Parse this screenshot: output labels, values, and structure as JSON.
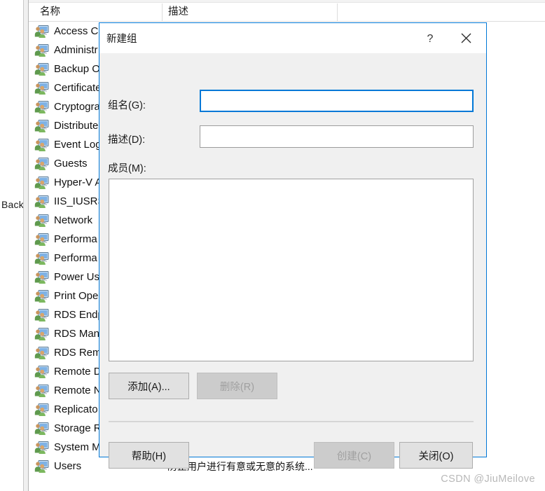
{
  "background": {
    "back_label": "Back",
    "columns": [
      {
        "key": "name",
        "label": "名称"
      },
      {
        "key": "desc",
        "label": "描述"
      },
      {
        "key": "extra",
        "label": ""
      }
    ],
    "rows": [
      {
        "icon": "user-group-icon",
        "name": "Access Co",
        "desc": ""
      },
      {
        "icon": "user-group-icon",
        "name": "Administr",
        "desc": ""
      },
      {
        "icon": "user-group-icon",
        "name": "Backup O",
        "desc": ""
      },
      {
        "icon": "user-group-icon",
        "name": "Certificate",
        "desc": ""
      },
      {
        "icon": "user-group-icon",
        "name": "Cryptogra",
        "desc": ""
      },
      {
        "icon": "user-group-icon",
        "name": "Distribute",
        "desc": ""
      },
      {
        "icon": "user-group-icon",
        "name": "Event Log",
        "desc": ""
      },
      {
        "icon": "user-group-icon",
        "name": "Guests",
        "desc": ""
      },
      {
        "icon": "user-group-icon",
        "name": "Hyper-V A",
        "desc": ""
      },
      {
        "icon": "user-group-icon",
        "name": "IIS_IUSRS",
        "desc": ""
      },
      {
        "icon": "user-group-icon",
        "name": "Network",
        "desc": ""
      },
      {
        "icon": "user-group-icon",
        "name": "Performa",
        "desc": ""
      },
      {
        "icon": "user-group-icon",
        "name": "Performa",
        "desc": ""
      },
      {
        "icon": "user-group-icon",
        "name": "Power Us",
        "desc": ""
      },
      {
        "icon": "user-group-icon",
        "name": "Print Ope",
        "desc": ""
      },
      {
        "icon": "user-group-icon",
        "name": "RDS Endp",
        "desc": ""
      },
      {
        "icon": "user-group-icon",
        "name": "RDS Man",
        "desc": ""
      },
      {
        "icon": "user-group-icon",
        "name": "RDS Rem",
        "desc": ""
      },
      {
        "icon": "user-group-icon",
        "name": "Remote D",
        "desc": ""
      },
      {
        "icon": "user-group-icon",
        "name": "Remote N",
        "desc": ""
      },
      {
        "icon": "user-group-icon",
        "name": "Replicato",
        "desc": ""
      },
      {
        "icon": "user-group-icon",
        "name": "Storage R",
        "desc": ""
      },
      {
        "icon": "user-group-icon",
        "name": "System M",
        "desc": ""
      },
      {
        "icon": "user-group-icon",
        "name": "Users",
        "desc": "防止用户进行有意或无意的系统..."
      }
    ]
  },
  "dialog": {
    "title": "新建组",
    "help_icon": "question-mark-icon",
    "close_icon": "close-icon",
    "fields": {
      "group_name": {
        "label": "组名(G):",
        "value": "",
        "placeholder": ""
      },
      "description": {
        "label": "描述(D):",
        "value": "",
        "placeholder": ""
      },
      "members": {
        "label": "成员(M):",
        "items": []
      }
    },
    "buttons": {
      "add": "添加(A)...",
      "remove": "删除(R)",
      "help": "帮助(H)",
      "create": "创建(C)",
      "close": "关闭(O)"
    }
  },
  "watermark": "CSDN @JiuMeilove",
  "colors": {
    "accent": "#0078d7",
    "dialog_bg": "#f0f0f0",
    "button_bg": "#e1e1e1",
    "button_disabled_bg": "#cccccc",
    "disabled_text": "#a0a0a0",
    "watermark_text": "#b8b8b8"
  }
}
